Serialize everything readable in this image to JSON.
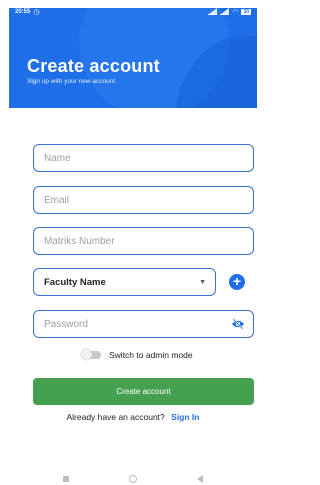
{
  "status_bar": {
    "time": "20:55",
    "battery": "30"
  },
  "header": {
    "title": "Create account",
    "subtitle": "Sign up with your new account"
  },
  "form": {
    "name_placeholder": "Name",
    "email_placeholder": "Email",
    "matriks_placeholder": "Matriks Number",
    "faculty_selected": "Faculty Name",
    "password_placeholder": "Password",
    "switch_label": "Switch to admin mode",
    "switch_on": false,
    "submit_label": "Create account",
    "signin_prompt": "Already have an account?",
    "signin_link": "Sign In"
  },
  "colors": {
    "primary_blue": "#1e6ee8",
    "field_border": "#3b6fd6",
    "button_green": "#45a04f"
  },
  "icons": [
    "alarm-icon",
    "signal-icon",
    "wifi-icon",
    "battery-icon",
    "add-icon",
    "eye-off-icon",
    "chevron-down-icon"
  ]
}
